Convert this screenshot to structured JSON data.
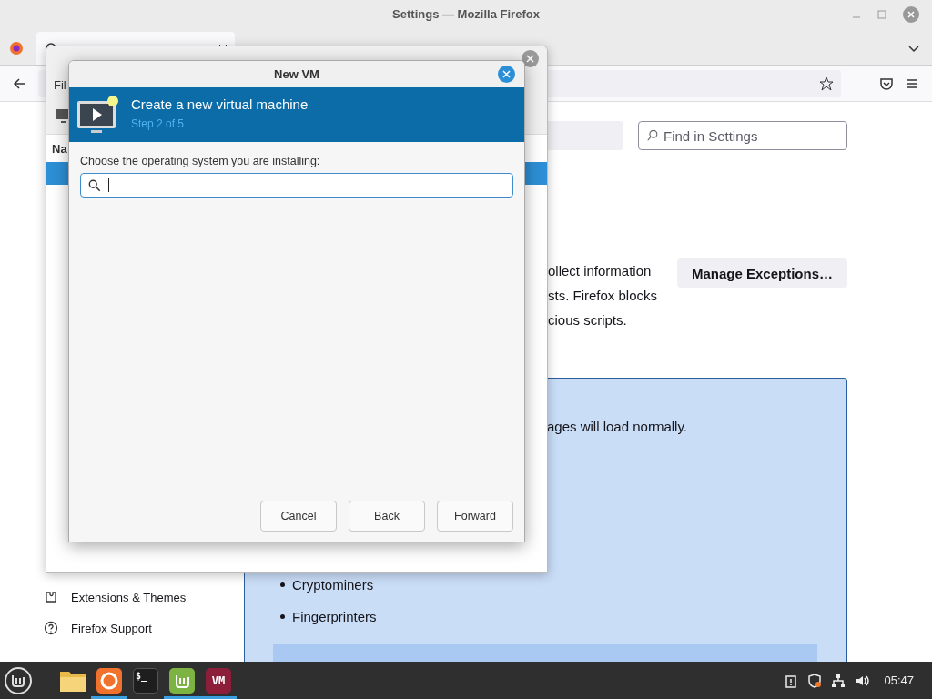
{
  "firefox": {
    "title": "Settings — Mozilla Firefox",
    "tabs": [
      {
        "selected": true
      }
    ],
    "search": {
      "placeholder": "Find in Settings"
    },
    "paragraph_lines": [
      "ollect information",
      "sts. Firefox blocks",
      "cious scripts."
    ],
    "manage_button": "Manage Exceptions…",
    "notice_line": "ages will load normally.",
    "blocked_list": [
      "Cryptominers",
      "Fingerprinters"
    ],
    "sidebar": [
      {
        "label": "Extensions & Themes",
        "kind": "extensions"
      },
      {
        "label": "Firefox Support",
        "kind": "support"
      }
    ]
  },
  "vmm": {
    "menu": [
      "Fil"
    ],
    "column_header": "Na"
  },
  "new_vm": {
    "title": "New VM",
    "header": {
      "title": "Create a new virtual machine",
      "step": "Step 2 of 5"
    },
    "prompt": "Choose the operating system you are installing:",
    "buttons": [
      {
        "label": "Cancel"
      },
      {
        "label": "Back"
      },
      {
        "label": "Forward"
      }
    ]
  },
  "taskbar": {
    "apps": [
      {
        "kind": "folder",
        "running": false
      },
      {
        "kind": "firefox",
        "running": true
      },
      {
        "kind": "terminal",
        "label": "$_",
        "running": false
      },
      {
        "kind": "mint",
        "running": true
      },
      {
        "kind": "vm",
        "label": "VM",
        "running": true
      }
    ],
    "tray": [
      {
        "kind": "clipboard"
      },
      {
        "kind": "shield"
      },
      {
        "kind": "network"
      },
      {
        "kind": "volume"
      }
    ],
    "clock": "05:47"
  }
}
